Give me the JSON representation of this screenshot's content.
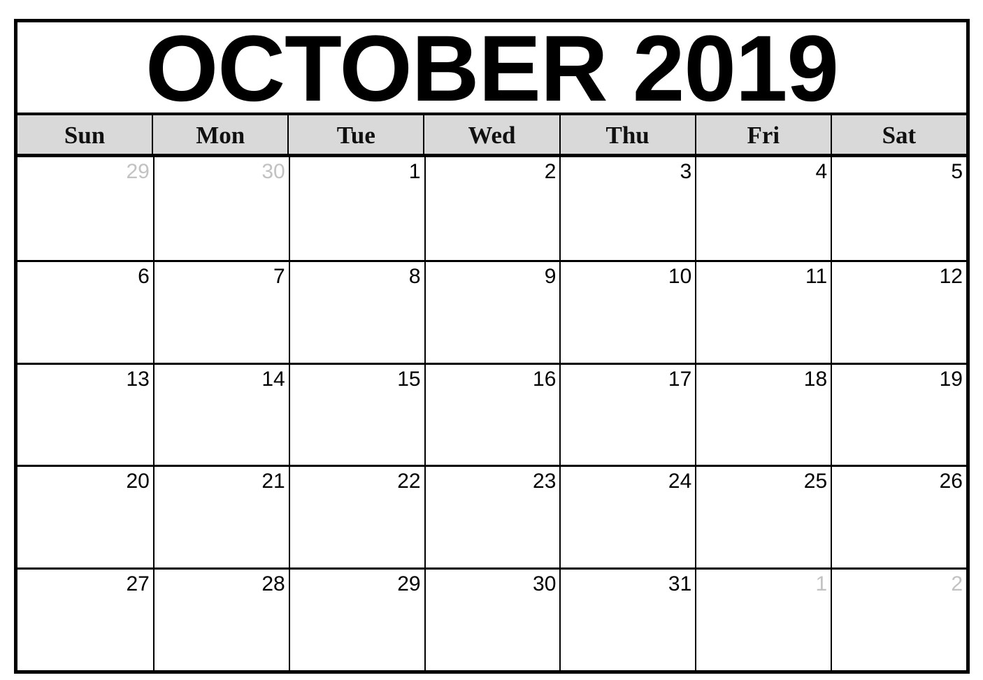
{
  "calendar": {
    "title": "OCTOBER 2019",
    "month": "October",
    "year": 2019,
    "weekdays": [
      "Sun",
      "Mon",
      "Tue",
      "Wed",
      "Thu",
      "Fri",
      "Sat"
    ],
    "colors": {
      "header_background": "#d9d9d9",
      "line": "#000000",
      "current_month_text": "#000000",
      "other_month_text": "#c2c2c2"
    },
    "weeks": [
      [
        {
          "day": "29",
          "current_month": false
        },
        {
          "day": "30",
          "current_month": false
        },
        {
          "day": "1",
          "current_month": true
        },
        {
          "day": "2",
          "current_month": true
        },
        {
          "day": "3",
          "current_month": true
        },
        {
          "day": "4",
          "current_month": true
        },
        {
          "day": "5",
          "current_month": true
        }
      ],
      [
        {
          "day": "6",
          "current_month": true
        },
        {
          "day": "7",
          "current_month": true
        },
        {
          "day": "8",
          "current_month": true
        },
        {
          "day": "9",
          "current_month": true
        },
        {
          "day": "10",
          "current_month": true
        },
        {
          "day": "11",
          "current_month": true
        },
        {
          "day": "12",
          "current_month": true
        }
      ],
      [
        {
          "day": "13",
          "current_month": true
        },
        {
          "day": "14",
          "current_month": true
        },
        {
          "day": "15",
          "current_month": true
        },
        {
          "day": "16",
          "current_month": true
        },
        {
          "day": "17",
          "current_month": true
        },
        {
          "day": "18",
          "current_month": true
        },
        {
          "day": "19",
          "current_month": true
        }
      ],
      [
        {
          "day": "20",
          "current_month": true
        },
        {
          "day": "21",
          "current_month": true
        },
        {
          "day": "22",
          "current_month": true
        },
        {
          "day": "23",
          "current_month": true
        },
        {
          "day": "24",
          "current_month": true
        },
        {
          "day": "25",
          "current_month": true
        },
        {
          "day": "26",
          "current_month": true
        }
      ],
      [
        {
          "day": "27",
          "current_month": true
        },
        {
          "day": "28",
          "current_month": true
        },
        {
          "day": "29",
          "current_month": true
        },
        {
          "day": "30",
          "current_month": true
        },
        {
          "day": "31",
          "current_month": true
        },
        {
          "day": "1",
          "current_month": false
        },
        {
          "day": "2",
          "current_month": false
        }
      ]
    ]
  }
}
